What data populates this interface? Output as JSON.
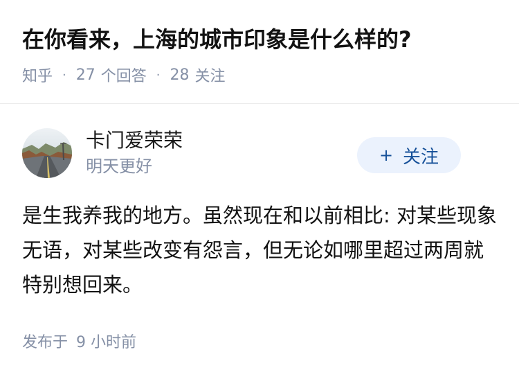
{
  "question": {
    "title": "在你看来，上海的城市印象是什么样的?",
    "source": "知乎",
    "answer_count": "27",
    "answer_label": "个回答",
    "follow_count": "28",
    "follow_label": "关注"
  },
  "answer": {
    "author": {
      "name": "卡门爱荣荣",
      "bio": "明天更好",
      "avatar_icon": "road-landscape-avatar"
    },
    "follow_button": {
      "icon": "plus",
      "label": "关注"
    },
    "content": "是生我养我的地方。虽然现在和以前相比: 对某些现象无语，对某些改变有怨言，但无论如哪里超过两周就特别想回来。",
    "footer": {
      "published_label": "发布于",
      "published_time": "9 小时前"
    }
  },
  "colors": {
    "accent": "#175199",
    "button_bg": "#ebf2fd",
    "meta_text": "#8590a6"
  }
}
